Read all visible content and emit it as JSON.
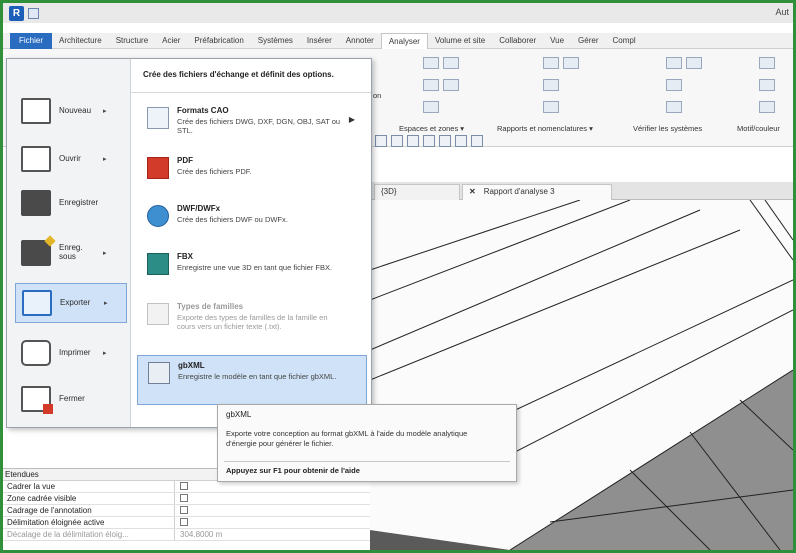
{
  "titlebar": {
    "title": "Aut",
    "logo": "R"
  },
  "ribbon": {
    "tabs": [
      "Fichier",
      "Architecture",
      "Structure",
      "Acier",
      "Préfabrication",
      "Systèmes",
      "Insérer",
      "Annoter",
      "Analyser",
      "Volume et site",
      "Collaborer",
      "Vue",
      "Gérer",
      "Compl"
    ],
    "active_tab": "Analyser",
    "groups": [
      "Espaces et zones ▾",
      "Rapports et nomenclatures ▾",
      "Vérifier les systèmes",
      "Motif/couleur"
    ],
    "partial_label": "on"
  },
  "appmenu": {
    "header": "Crée des fichiers d'échange et définit des options.",
    "commands": [
      {
        "label": "Nouveau",
        "has_arrow": true,
        "icon": "new-file-icon"
      },
      {
        "label": "Ouvrir",
        "has_arrow": true,
        "icon": "open-folder-icon"
      },
      {
        "label": "Enregistrer",
        "has_arrow": false,
        "icon": "save-icon"
      },
      {
        "label": "Enreg. sous",
        "has_arrow": true,
        "icon": "save-as-icon"
      },
      {
        "label": "Exporter",
        "has_arrow": true,
        "icon": "export-icon"
      },
      {
        "label": "Imprimer",
        "has_arrow": true,
        "icon": "print-icon"
      },
      {
        "label": "Fermer",
        "has_arrow": false,
        "icon": "close-file-icon"
      }
    ],
    "selected_command": "Exporter",
    "export_items": [
      {
        "title": "Formats CAO",
        "desc": "Crée des fichiers DWG, DXF, DGN, OBJ, SAT ou STL.",
        "icon": "cad-icon",
        "arrow": "▶"
      },
      {
        "title": "PDF",
        "desc": "Crée des fichiers PDF.",
        "icon": "pdf-icon"
      },
      {
        "title": "DWF/DWFx",
        "desc": "Crée des fichiers DWF ou DWFx.",
        "icon": "dwf-globe-icon"
      },
      {
        "title": "FBX",
        "desc": "Enregistre une vue 3D en tant que fichier FBX.",
        "icon": "fbx-icon"
      },
      {
        "title": "Types de familles",
        "desc": "Exporte des types de familles de la famille en cours vers un fichier texte (.txt).",
        "icon": "family-types-icon",
        "disabled": true
      },
      {
        "title": "gbXML",
        "desc": "Enregistre le modèle en tant que fichier gbXML.",
        "icon": "gbxml-icon",
        "selected": true
      }
    ]
  },
  "tooltip": {
    "title": "gbXML",
    "body": "Exporte votre conception au format gbXML à l'aide du modèle analytique d'énergie pour générer le fichier.",
    "help": "Appuyez sur F1 pour obtenir de l'aide"
  },
  "view_tabs": [
    {
      "label": "{3D}"
    },
    {
      "label": "Rapport d'analyse 3",
      "close": "✕"
    }
  ],
  "properties": {
    "section": "Etendues",
    "rows": [
      {
        "name": "Cadrer la vue",
        "checked": false
      },
      {
        "name": "Zone cadrée visible",
        "checked": false
      },
      {
        "name": "Cadrage de l'annotation",
        "checked": false
      },
      {
        "name": "Délimitation éloignée active",
        "checked": false
      },
      {
        "name": "Décalage de la délimitation éloig...",
        "value": "304.8000 m",
        "faded": true
      }
    ]
  }
}
